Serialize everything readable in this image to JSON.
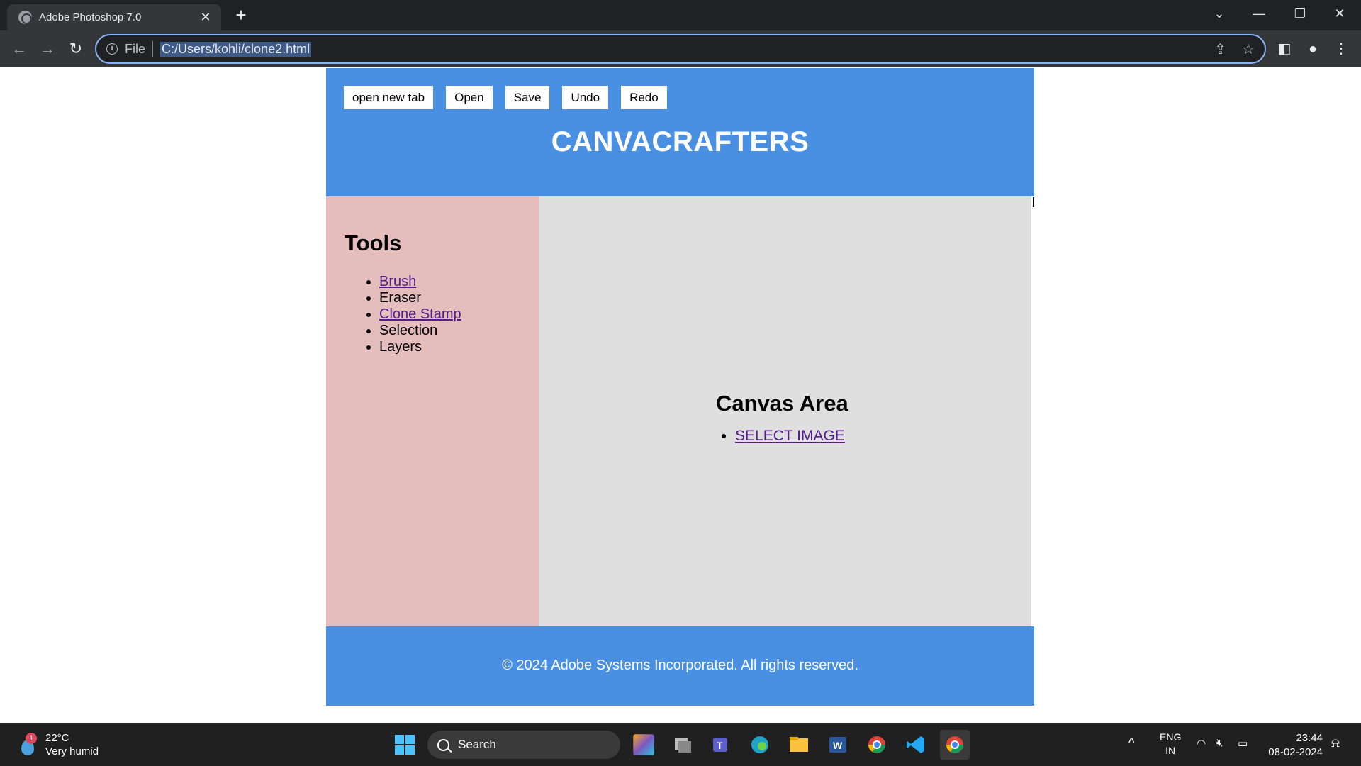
{
  "browser": {
    "tab_title": "Adobe Photoshop 7.0",
    "tab_close": "✕",
    "new_tab": "+",
    "scheme_label": "File",
    "url": "C:/Users/kohli/clone2.html"
  },
  "header": {
    "buttons": [
      "open new tab",
      "Open",
      "Save",
      "Undo",
      "Redo"
    ],
    "title": "CANVACRAFTERS"
  },
  "sidebar": {
    "heading": "Tools",
    "items": [
      {
        "label": "Brush",
        "link": true
      },
      {
        "label": "Eraser",
        "link": false
      },
      {
        "label": "Clone Stamp",
        "link": true
      },
      {
        "label": "Selection",
        "link": false
      },
      {
        "label": "Layers",
        "link": false
      }
    ]
  },
  "canvas": {
    "heading": "Canvas Area",
    "link_label": "SELECT IMAGE"
  },
  "footer": {
    "text": "© 2024 Adobe Systems Incorporated. All rights reserved."
  },
  "taskbar": {
    "weather_temp": "22°C",
    "weather_desc": "Very humid",
    "weather_badge": "1",
    "search_label": "Search",
    "lang_line1": "ENG",
    "lang_line2": "IN",
    "time": "23:44",
    "date": "08-02-2024"
  },
  "colors": {
    "header_blue": "#4a90e2",
    "sidebar_pink": "#e6bdbd",
    "canvas_grey": "#dfdfdf",
    "visited_link": "#551a8b"
  }
}
